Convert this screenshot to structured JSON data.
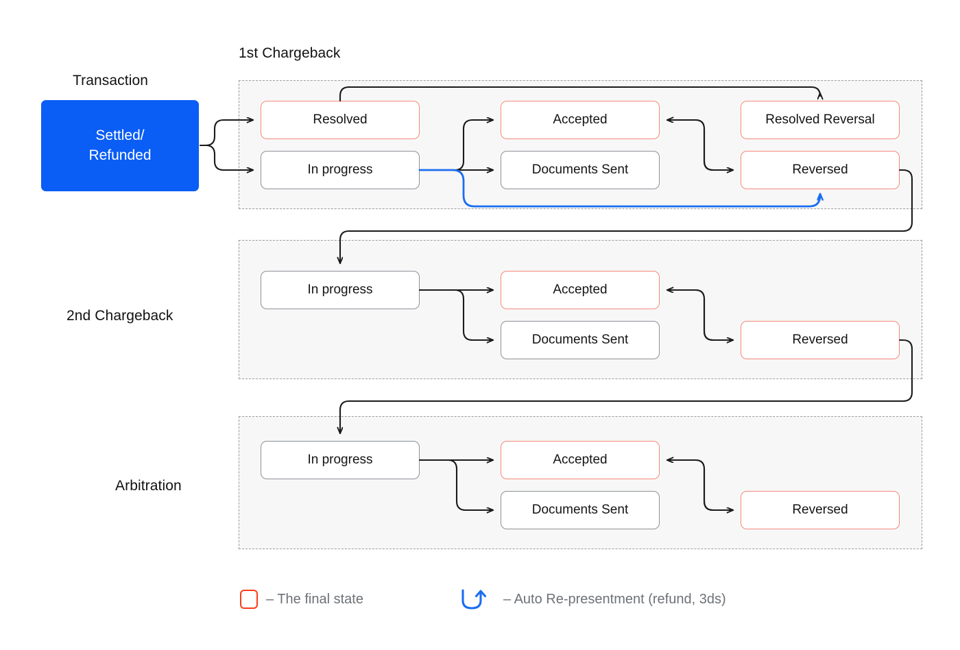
{
  "diagram": {
    "title_hidden": "",
    "colors": {
      "start_fill": "#0a5df5",
      "final_border": "#f4897a",
      "normal_border": "#8d9196",
      "group_border": "#9b9b9b",
      "group_fill": "#f7f7f7",
      "arrow": "#1a1a1a",
      "auto_representment": "#1a6df0",
      "legend_swatch": "#fb3c16",
      "legend_text": "#6d7176"
    }
  },
  "transaction": {
    "label": "Transaction",
    "start_node": "Settled/\nRefunded",
    "start_node_line1": "Settled/",
    "start_node_line2": "Refunded"
  },
  "sections": [
    {
      "key": "first-chargeback",
      "title": "1st Chargeback",
      "title_position": "top",
      "nodes": [
        {
          "key": "resolved",
          "label": "Resolved",
          "final": true
        },
        {
          "key": "in-progress",
          "label": "In progress",
          "final": false
        },
        {
          "key": "accepted",
          "label": "Accepted",
          "final": true
        },
        {
          "key": "documents-sent",
          "label": "Documents Sent",
          "final": false
        },
        {
          "key": "resolved-reversal",
          "label": "Resolved Reversal",
          "final": true
        },
        {
          "key": "reversed",
          "label": "Reversed",
          "final": true
        }
      ]
    },
    {
      "key": "second-chargeback",
      "title": "2nd Chargeback",
      "title_position": "left",
      "nodes": [
        {
          "key": "in-progress",
          "label": "In progress",
          "final": false
        },
        {
          "key": "accepted",
          "label": "Accepted",
          "final": true
        },
        {
          "key": "documents-sent",
          "label": "Documents Sent",
          "final": false
        },
        {
          "key": "reversed",
          "label": "Reversed",
          "final": true
        }
      ]
    },
    {
      "key": "arbitration",
      "title": "Arbitration",
      "title_position": "left",
      "nodes": [
        {
          "key": "in-progress",
          "label": "In progress",
          "final": false
        },
        {
          "key": "accepted",
          "label": "Accepted",
          "final": true
        },
        {
          "key": "documents-sent",
          "label": "Documents Sent",
          "final": false
        },
        {
          "key": "reversed",
          "label": "Reversed",
          "final": true
        }
      ]
    }
  ],
  "legend": {
    "final_state": "– The final state",
    "auto_representment": "– Auto Re-presentment (refund, 3ds)",
    "final_state_icon": "rounded-square-outline-icon",
    "auto_representment_icon": "u-turn-arrow-icon"
  }
}
